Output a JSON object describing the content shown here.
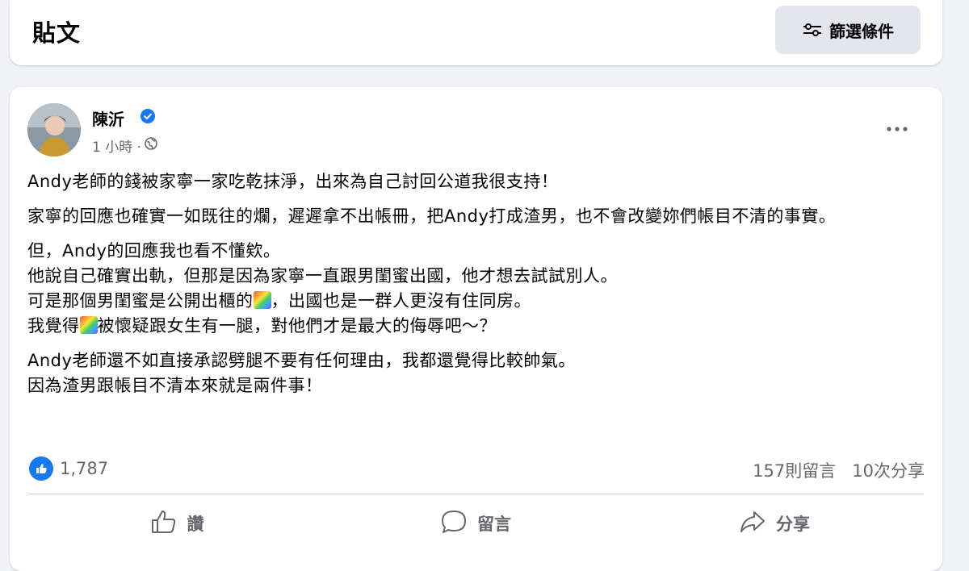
{
  "header": {
    "title": "貼文",
    "filter_label": "篩選條件"
  },
  "post": {
    "author": "陳沂",
    "time": "1 小時 ·",
    "paragraphs": [
      [
        "Andy老師的錢被家寧一家吃乾抹淨，出來為自己討回公道我很支持！"
      ],
      [
        "家寧的回應也確實一如既往的爛，遲遲拿不出帳冊，把Andy打成渣男，也不會改變妳們帳目不清的事實。"
      ],
      [
        "但，Andy的回應我也看不懂欸。",
        "他說自己確實出軌，但那是因為家寧一直跟男閨蜜出國，他才想去試試別人。"
      ],
      [
        "Andy老師還不如直接承認劈腿不要有任何理由，我都還覺得比較帥氣。",
        "因為渣男跟帳目不清本來就是兩件事！"
      ]
    ],
    "line_rainbow_1_before": "可是那個男閨蜜是公開出櫃的",
    "line_rainbow_1_after": "，出國也是一群人更沒有住同房。",
    "line_rainbow_2_before": "我覺得",
    "line_rainbow_2_after": "被懷疑跟女生有一腿，對他們才是最大的侮辱吧～？",
    "reaction_count": "1,787",
    "comments": "157則留言",
    "shares": "10次分享"
  },
  "actions": {
    "like": "讚",
    "comment": "留言",
    "share": "分享"
  },
  "colors": {
    "accent": "#1877f2",
    "page_bg": "#f0f2f5",
    "button_bg": "#e4e6eb",
    "secondary_text": "#65676b"
  }
}
